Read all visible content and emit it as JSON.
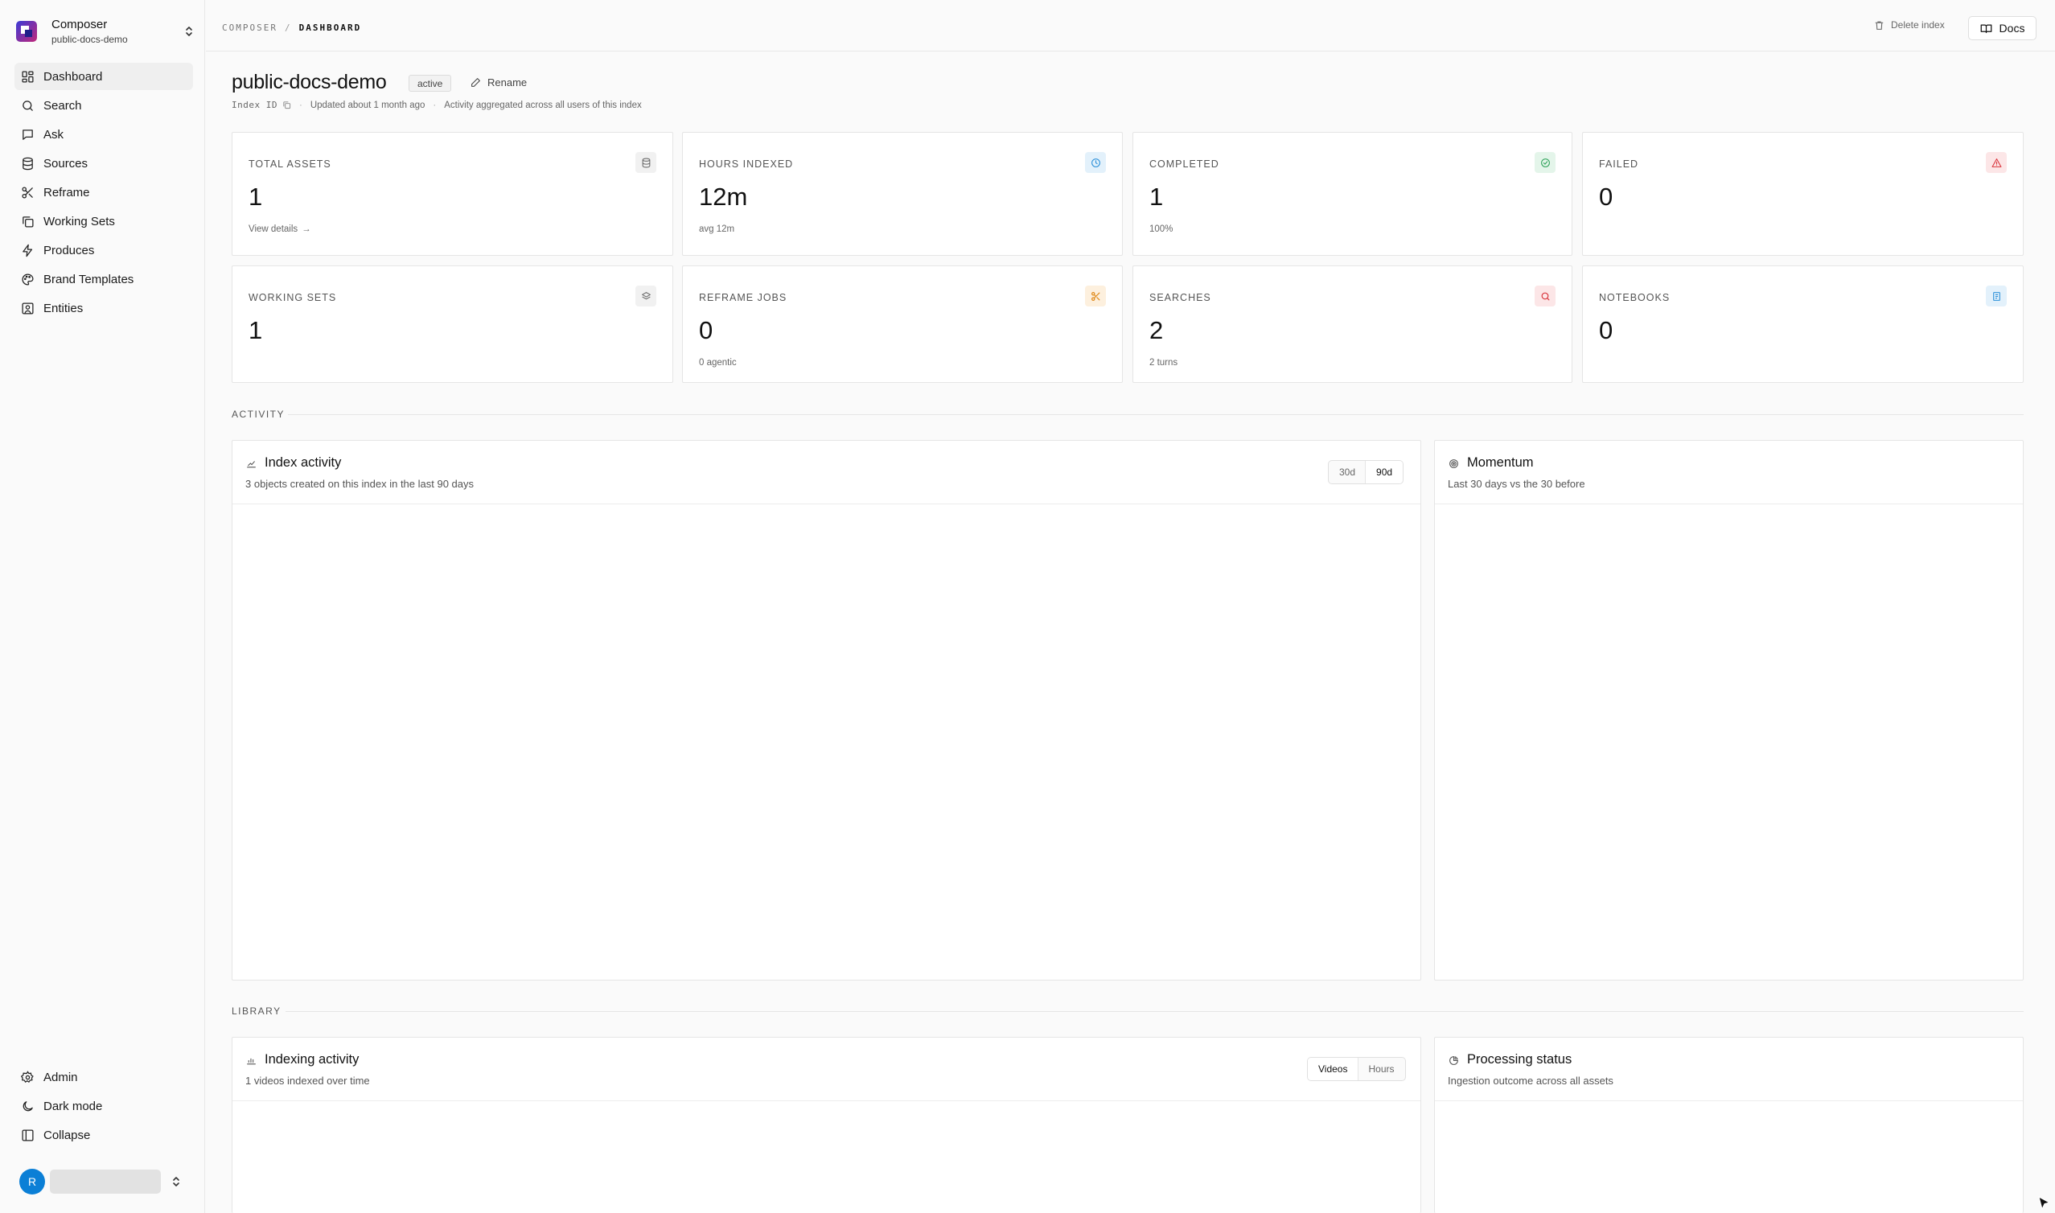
{
  "workspace": {
    "name": "Composer",
    "index": "public-docs-demo"
  },
  "nav": {
    "items": [
      {
        "label": "Dashboard",
        "icon": "dashboard-icon",
        "active": true
      },
      {
        "label": "Search",
        "icon": "search-icon"
      },
      {
        "label": "Ask",
        "icon": "chat-icon"
      },
      {
        "label": "Sources",
        "icon": "database-icon"
      },
      {
        "label": "Reframe",
        "icon": "scissors-icon"
      },
      {
        "label": "Working Sets",
        "icon": "copy-icon"
      },
      {
        "label": "Produces",
        "icon": "zap-icon"
      },
      {
        "label": "Brand Templates",
        "icon": "palette-icon"
      },
      {
        "label": "Entities",
        "icon": "contact-icon"
      }
    ],
    "bottom": [
      {
        "label": "Admin",
        "icon": "gear-icon"
      },
      {
        "label": "Dark mode",
        "icon": "moon-icon"
      },
      {
        "label": "Collapse",
        "icon": "panel-icon"
      }
    ]
  },
  "user": {
    "initial": "R"
  },
  "breadcrumb": {
    "root": "COMPOSER",
    "separator": "/",
    "current": "DASHBOARD"
  },
  "topbar": {
    "delete_label": "Delete index",
    "docs_label": "Docs"
  },
  "header": {
    "title": "public-docs-demo",
    "status": "active",
    "rename_label": "Rename",
    "index_id_label": "Index ID",
    "dot": "·",
    "updated": "Updated about 1 month ago",
    "activity_note": "Activity aggregated across all users of this index"
  },
  "stats": [
    {
      "label": "TOTAL ASSETS",
      "value": "1",
      "sub": "View details",
      "sub_arrow": "→",
      "icon": "database-icon",
      "color": "#6b6b6b"
    },
    {
      "label": "HOURS INDEXED",
      "value": "12m",
      "sub": "avg 12m",
      "icon": "clock-icon",
      "color": "#2a8fd8"
    },
    {
      "label": "COMPLETED",
      "value": "1",
      "sub": "100%",
      "icon": "check-circle-icon",
      "color": "#2fa35a"
    },
    {
      "label": "FAILED",
      "value": "0",
      "sub": "",
      "icon": "alert-triangle-icon",
      "color": "#d9363e"
    },
    {
      "label": "WORKING SETS",
      "value": "1",
      "sub": "",
      "icon": "layers-icon",
      "color": "#6b6b6b"
    },
    {
      "label": "REFRAME JOBS",
      "value": "0",
      "sub": "0 agentic",
      "icon": "scissors-icon",
      "color": "#e08a1a"
    },
    {
      "label": "SEARCHES",
      "value": "2",
      "sub": "2 turns",
      "icon": "search-icon",
      "color": "#d9363e"
    },
    {
      "label": "NOTEBOOKS",
      "value": "0",
      "sub": "",
      "icon": "notebook-icon",
      "color": "#2a8fd8"
    }
  ],
  "sections": {
    "activity": "ACTIVITY",
    "library": "LIBRARY"
  },
  "panels": {
    "index_activity": {
      "title": "Index activity",
      "subtitle": "3 objects created on this index in the last 90 days",
      "ranges": [
        "30d",
        "90d"
      ],
      "selected": "90d"
    },
    "momentum": {
      "title": "Momentum",
      "subtitle": "Last 30 days vs the 30 before"
    },
    "indexing_activity": {
      "title": "Indexing activity",
      "subtitle": "1 videos indexed over time",
      "modes": [
        "Videos",
        "Hours"
      ],
      "selected": "Videos"
    },
    "processing_status": {
      "title": "Processing status",
      "subtitle": "Ingestion outcome across all assets"
    }
  }
}
